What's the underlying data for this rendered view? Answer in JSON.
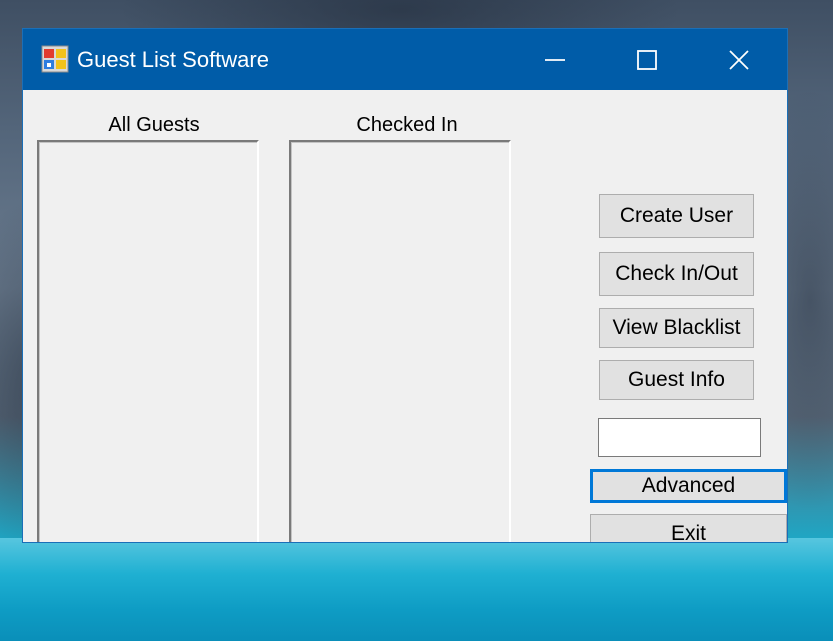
{
  "window": {
    "title": "Guest List Software",
    "accent_color": "#005ca8",
    "controls": {
      "minimize_icon": "minimize-icon",
      "maximize_icon": "maximize-icon",
      "close_icon": "close-icon"
    }
  },
  "lists": {
    "all_guests_label": "All Guests",
    "checked_in_label": "Checked In",
    "all_guests_items": [],
    "checked_in_items": []
  },
  "actions": {
    "create_user": "Create User",
    "check_in_out": "Check In/Out",
    "view_blacklist": "View Blacklist",
    "guest_info": "Guest Info",
    "input_value": "",
    "advanced": "Advanced",
    "exit": "Exit"
  },
  "focus_color": "#0078d7"
}
